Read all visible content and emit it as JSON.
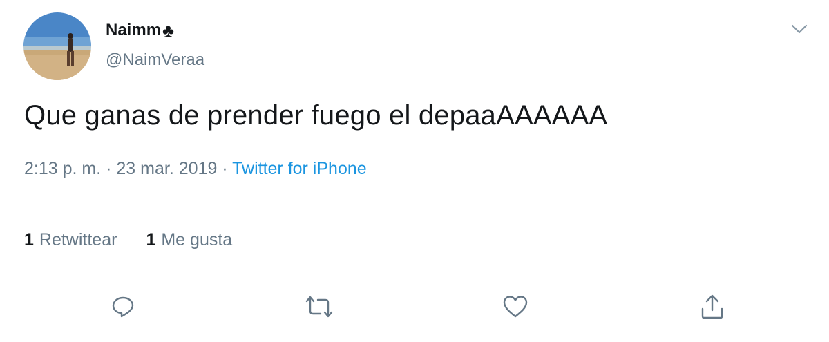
{
  "user": {
    "display_name": "Naimm",
    "name_emoji": "♣",
    "handle": "@NaimVeraa"
  },
  "tweet": {
    "text": "Que ganas de prender fuego el depaaAAAAAA",
    "time": "2:13 p. m.",
    "separator": "·",
    "date": "23 mar. 2019",
    "source": "Twitter for iPhone"
  },
  "stats": {
    "retweets_count": "1",
    "retweets_label": "Retwittear",
    "likes_count": "1",
    "likes_label": "Me gusta"
  },
  "icons": {
    "more": "chevron-down-icon",
    "reply": "reply-icon",
    "retweet": "retweet-icon",
    "like": "heart-icon",
    "share": "share-icon"
  },
  "colors": {
    "text": "#14171a",
    "secondary": "#657786",
    "link": "#1b95e0",
    "divider": "#e6ecf0"
  }
}
